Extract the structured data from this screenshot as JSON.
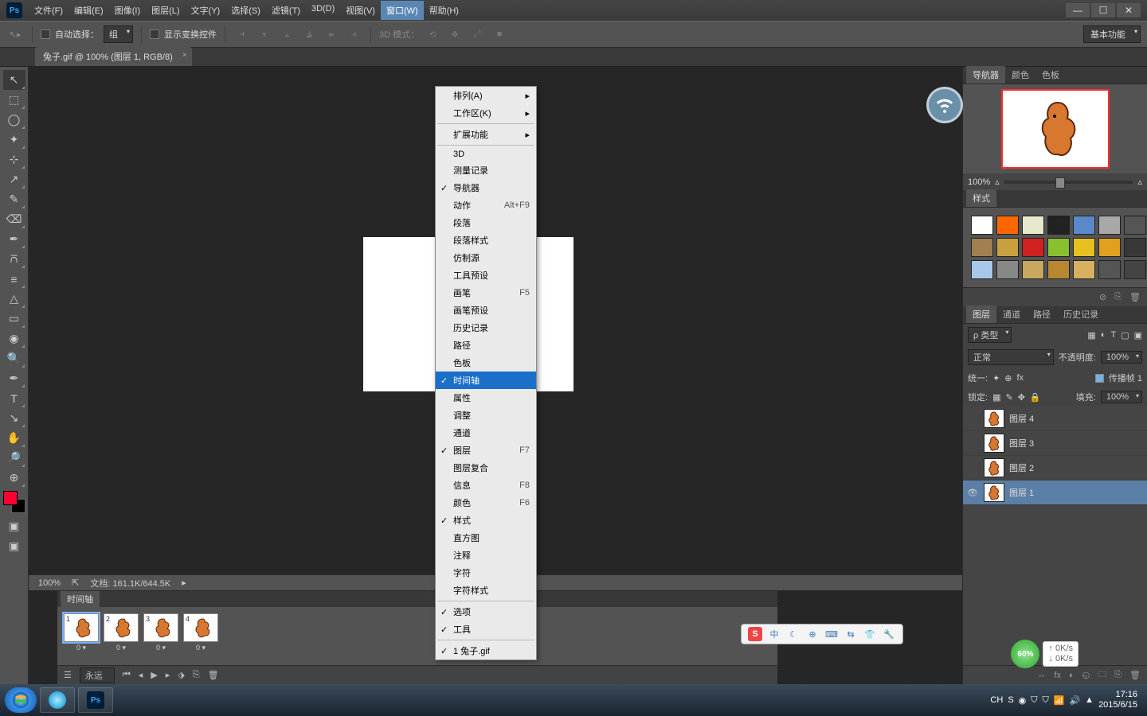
{
  "menu": {
    "items": [
      "文件(F)",
      "编辑(E)",
      "图像(I)",
      "图层(L)",
      "文字(Y)",
      "选择(S)",
      "滤镜(T)",
      "3D(D)",
      "视图(V)",
      "窗口(W)",
      "帮助(H)"
    ],
    "active_index": 9
  },
  "window_menu": {
    "groups": [
      [
        {
          "label": "排列(A)",
          "arrow": true
        },
        {
          "label": "工作区(K)",
          "arrow": true
        }
      ],
      [
        {
          "label": "扩展功能",
          "arrow": true
        }
      ],
      [
        {
          "label": "3D"
        },
        {
          "label": "测量记录"
        },
        {
          "label": "导航器",
          "checked": true
        },
        {
          "label": "动作",
          "shortcut": "Alt+F9"
        },
        {
          "label": "段落"
        },
        {
          "label": "段落样式"
        },
        {
          "label": "仿制源"
        },
        {
          "label": "工具预设"
        },
        {
          "label": "画笔",
          "shortcut": "F5"
        },
        {
          "label": "画笔预设"
        },
        {
          "label": "历史记录"
        },
        {
          "label": "路径"
        },
        {
          "label": "色板"
        },
        {
          "label": "时间轴",
          "checked": true,
          "highlight": true
        },
        {
          "label": "属性"
        },
        {
          "label": "调整"
        },
        {
          "label": "通道"
        },
        {
          "label": "图层",
          "checked": true,
          "shortcut": "F7"
        },
        {
          "label": "图层复合"
        },
        {
          "label": "信息",
          "shortcut": "F8"
        },
        {
          "label": "颜色",
          "shortcut": "F6"
        },
        {
          "label": "样式",
          "checked": true
        },
        {
          "label": "直方图"
        },
        {
          "label": "注释"
        },
        {
          "label": "字符"
        },
        {
          "label": "字符样式"
        }
      ],
      [
        {
          "label": "选项",
          "checked": true
        },
        {
          "label": "工具",
          "checked": true
        }
      ],
      [
        {
          "label": "1 兔子.gif",
          "checked": true
        }
      ]
    ]
  },
  "options_bar": {
    "auto_select_label": "自动选择：",
    "auto_select_value": "组",
    "show_transform_label": "显示变换控件",
    "mode3d_label": "3D 模式：",
    "workspace_selector": "基本功能"
  },
  "document_tab": "兔子.gif @ 100% (图层 1, RGB/8)",
  "status": {
    "zoom": "100%",
    "doc": "文档: 161.1K/644.5K"
  },
  "panels": {
    "navigator_tabs": [
      "导航器",
      "颜色",
      "色板"
    ],
    "navigator_zoom": "100%",
    "styles_tab": "样式",
    "styles_colors": [
      "#ffffff",
      "#ff6600",
      "#e8e8cc",
      "#222222",
      "#5a88c8",
      "#a8a8a8",
      "#555555",
      "#a08050",
      "#c8a040",
      "#d02020",
      "#88c030",
      "#e8c020",
      "#e0a020",
      "#383838",
      "#a8c8e8",
      "#888888",
      "#c8a860",
      "#b88830",
      "#d8b060",
      "#555555",
      "#444444"
    ],
    "layer_section_tabs": [
      "图层",
      "通道",
      "路径",
      "历史记录"
    ],
    "layer_filter_label": "ρ 类型",
    "blend_mode": "正常",
    "opacity_label": "不透明度:",
    "opacity_value": "100%",
    "unity_label": "统一:",
    "propagate_label": "传播帧 1",
    "lock_label": "锁定:",
    "fill_label": "填充:",
    "fill_value": "100%",
    "layers": [
      {
        "name": "图层 4",
        "visible": false
      },
      {
        "name": "图层 3",
        "visible": false
      },
      {
        "name": "图层 2",
        "visible": false
      },
      {
        "name": "图层 1",
        "visible": true,
        "active": true
      }
    ]
  },
  "timeline": {
    "tab": "时间轴",
    "frames": [
      {
        "n": "1",
        "d": "0 ▾"
      },
      {
        "n": "2",
        "d": "0 ▾"
      },
      {
        "n": "3",
        "d": "0 ▾"
      },
      {
        "n": "4",
        "d": "0 ▾"
      }
    ],
    "selected_frame": 0,
    "loop_label": "永远"
  },
  "ime": {
    "logo_label": "S",
    "items": [
      "中",
      "☾",
      "⊕",
      "⌨",
      "⇆",
      "👕",
      "🔧"
    ]
  },
  "net_badge": {
    "pct": "60%",
    "up": "0K/s",
    "down": "0K/s"
  },
  "taskbar": {
    "tray_items": [
      "CH",
      "S",
      "◉",
      "⛉",
      "⛉",
      "📶",
      "🔊",
      "▲"
    ],
    "time": "17:16",
    "date": "2015/6/15"
  },
  "tool_icons": [
    "↖",
    "⬚",
    "◯",
    "✦",
    "⊹",
    "↗",
    "✎",
    "⌫",
    "✒",
    "⩃",
    "≡",
    "△",
    "▭",
    "◉",
    "🔍",
    "✒",
    "T",
    "↘",
    "✋",
    "🔎",
    "⊕"
  ]
}
